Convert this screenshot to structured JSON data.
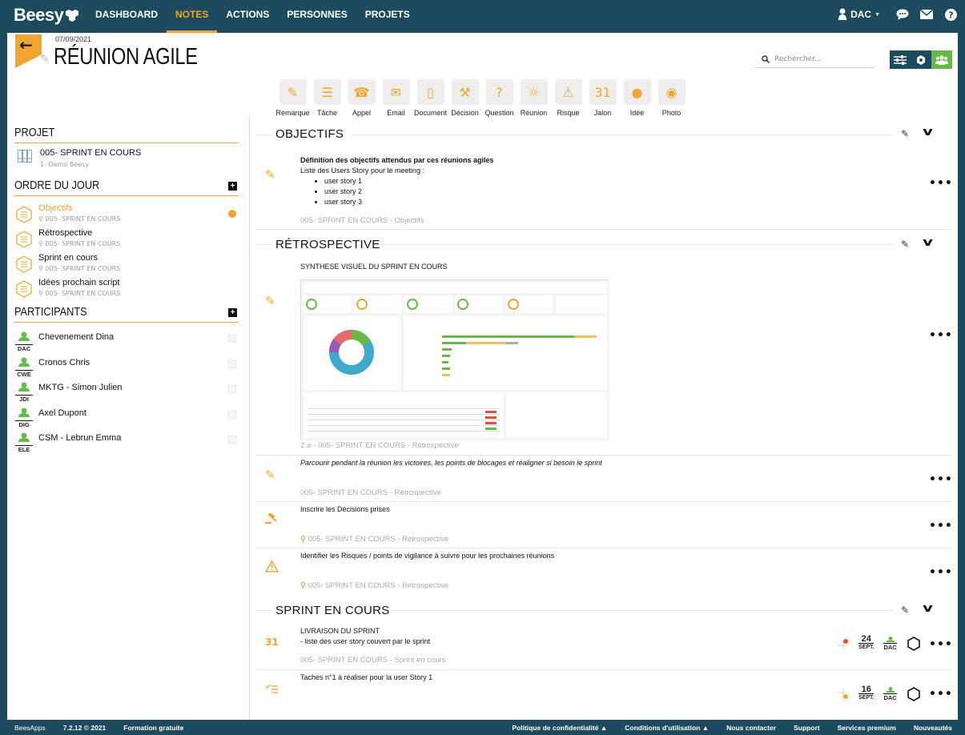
{
  "app": {
    "logo": "Beesy"
  },
  "nav": {
    "items": [
      "DASHBOARD",
      "NOTES",
      "ACTIONS",
      "PERSONNES",
      "PROJETS"
    ],
    "active_index": 1,
    "user_label": "DAC"
  },
  "colors": {
    "brand": "#1d4a5c",
    "accent": "#f0a531",
    "green": "#6bb84a"
  },
  "page": {
    "date": "07/09/2021",
    "title": "RÉUNION AGILE",
    "search_placeholder": "Rechercher..."
  },
  "note_types": [
    {
      "label": "Remarque",
      "icon": "pencil-icon"
    },
    {
      "label": "Tâche",
      "icon": "checklist-icon"
    },
    {
      "label": "Appel",
      "icon": "phone-icon"
    },
    {
      "label": "Email",
      "icon": "envelope-icon"
    },
    {
      "label": "Document",
      "icon": "document-icon"
    },
    {
      "label": "Décision",
      "icon": "gavel-icon"
    },
    {
      "label": "Question",
      "icon": "question-icon"
    },
    {
      "label": "Réunion",
      "icon": "meeting-icon"
    },
    {
      "label": "Risque",
      "icon": "warning-icon"
    },
    {
      "label": "Jalon",
      "icon": "calendar-icon"
    },
    {
      "label": "Idée",
      "icon": "bulb-icon"
    },
    {
      "label": "Photo",
      "icon": "camera-icon"
    }
  ],
  "sidebar": {
    "project_heading": "PROJET",
    "project": {
      "name": "005- SPRINT EN COURS",
      "sub": "1- Demo Beesy"
    },
    "agenda_heading": "ORDRE DU JOUR",
    "agenda": [
      {
        "name": "Objectifs",
        "sub": "005- SPRINT EN COURS",
        "active": true
      },
      {
        "name": "Rétrospective",
        "sub": "005- SPRINT EN COURS"
      },
      {
        "name": "Sprint en cours",
        "sub": "005- SPRINT EN COURS"
      },
      {
        "name": "Idées prochain script",
        "sub": "005- SPRINT EN COURS"
      }
    ],
    "participants_heading": "PARTICIPANTS",
    "participants": [
      {
        "code": "DAC",
        "name": "Chevenement Dina"
      },
      {
        "code": "CWE",
        "name": "Cronos Chris"
      },
      {
        "code": "JDI",
        "name": "MKTG - Simon Julien"
      },
      {
        "code": "DIG",
        "name": "Axel Dupont"
      },
      {
        "code": "ELE",
        "name": "CSM - Lebrun Emma"
      }
    ]
  },
  "groups": {
    "objectifs": {
      "title": "OBJECTIFS",
      "note1": {
        "heading": "Définition des objectifs attendus par ces réunions agiles",
        "line": "Liste des Users Story pour le meeting :",
        "bullets": [
          "user story 1",
          "user story 2",
          "user story 3"
        ],
        "meta": "005- SPRINT EN COURS - Objectifs"
      }
    },
    "retro": {
      "title": "RÉTROSPECTIVE",
      "note1": {
        "text": "SYNTHESE VISUEL DU SPRINT EN COURS",
        "meta_count": "2",
        "meta": "- 005- SPRINT EN COURS - Rétrospective"
      },
      "note2": {
        "text": "Parcourir pendant la réunion les victoires, les points de blocages et réaligner si besoin le sprint",
        "meta": "005- SPRINT EN COURS - Rétrospective"
      },
      "note3": {
        "text": "Inscrire les Décisions prises",
        "meta": "005- SPRINT EN COURS - Rétrospective"
      },
      "note4": {
        "text": "Identifier les Risques / points de vigilance à suivre pour les prochaines réunions",
        "meta": "005- SPRINT EN COURS - Rétrospective"
      }
    },
    "sprint": {
      "title": "SPRINT EN COURS",
      "note1": {
        "text": "LIVRAISON DU SPRINT",
        "line": " - liste des user story couvert par le sprint",
        "meta": "005- SPRINT EN COURS - Sprint en cours",
        "day": "24",
        "month": "SEPT.",
        "owner": "DAC"
      },
      "note2": {
        "text": "Taches n°1 à réaliser pour la user Story 1",
        "day": "16",
        "month": "SEPT.",
        "owner": "DAC"
      }
    }
  },
  "footer": {
    "brand": "BeesApps",
    "version": "7.2.12 © 2021",
    "links_left": [
      "Formation gratuite"
    ],
    "links_right": [
      "Politique de confidentialité",
      "Conditions d'utilisation",
      "Nous contacter",
      "Support",
      "Services premium",
      "Nouveautés"
    ]
  }
}
